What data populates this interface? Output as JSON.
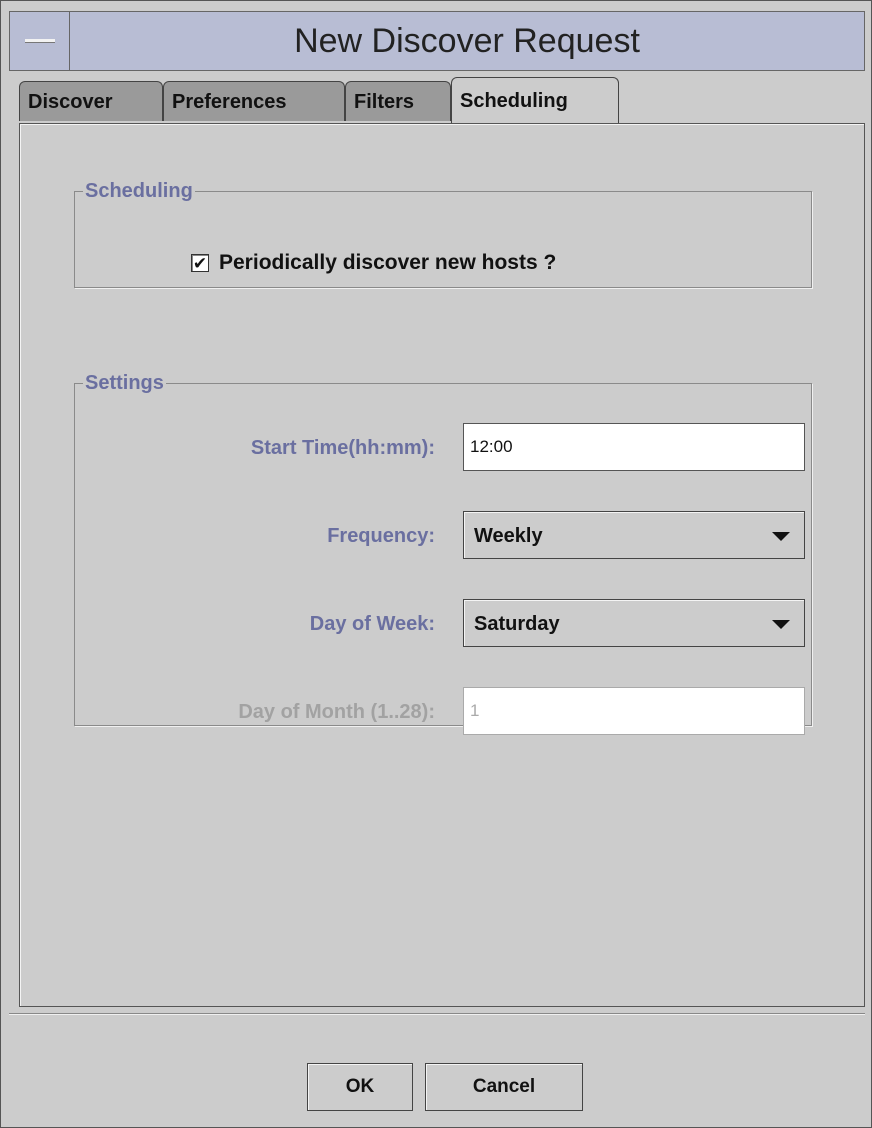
{
  "window": {
    "title": "New Discover Request"
  },
  "tabs": [
    {
      "label": "Discover",
      "active": false
    },
    {
      "label": "Preferences",
      "active": false
    },
    {
      "label": "Filters",
      "active": false
    },
    {
      "label": "Scheduling",
      "active": true
    }
  ],
  "scheduling": {
    "legend": "Scheduling",
    "periodic_checkbox": {
      "label": "Periodically discover new hosts ?",
      "checked": true,
      "mark": "✔"
    }
  },
  "settings": {
    "legend": "Settings",
    "start_time": {
      "label": "Start Time(hh:mm):",
      "value": "12:00"
    },
    "frequency": {
      "label": "Frequency:",
      "value": "Weekly"
    },
    "day_of_week": {
      "label": "Day of Week:",
      "value": "Saturday"
    },
    "day_of_month": {
      "label": "Day of Month (1..28):",
      "value": "1",
      "disabled": true
    }
  },
  "buttons": {
    "ok": "OK",
    "cancel": "Cancel"
  },
  "colors": {
    "background": "#cccccc",
    "titlebar": "#b8bdd4",
    "label_accent": "#6a6fa0",
    "disabled_text": "#a2a2a2"
  }
}
